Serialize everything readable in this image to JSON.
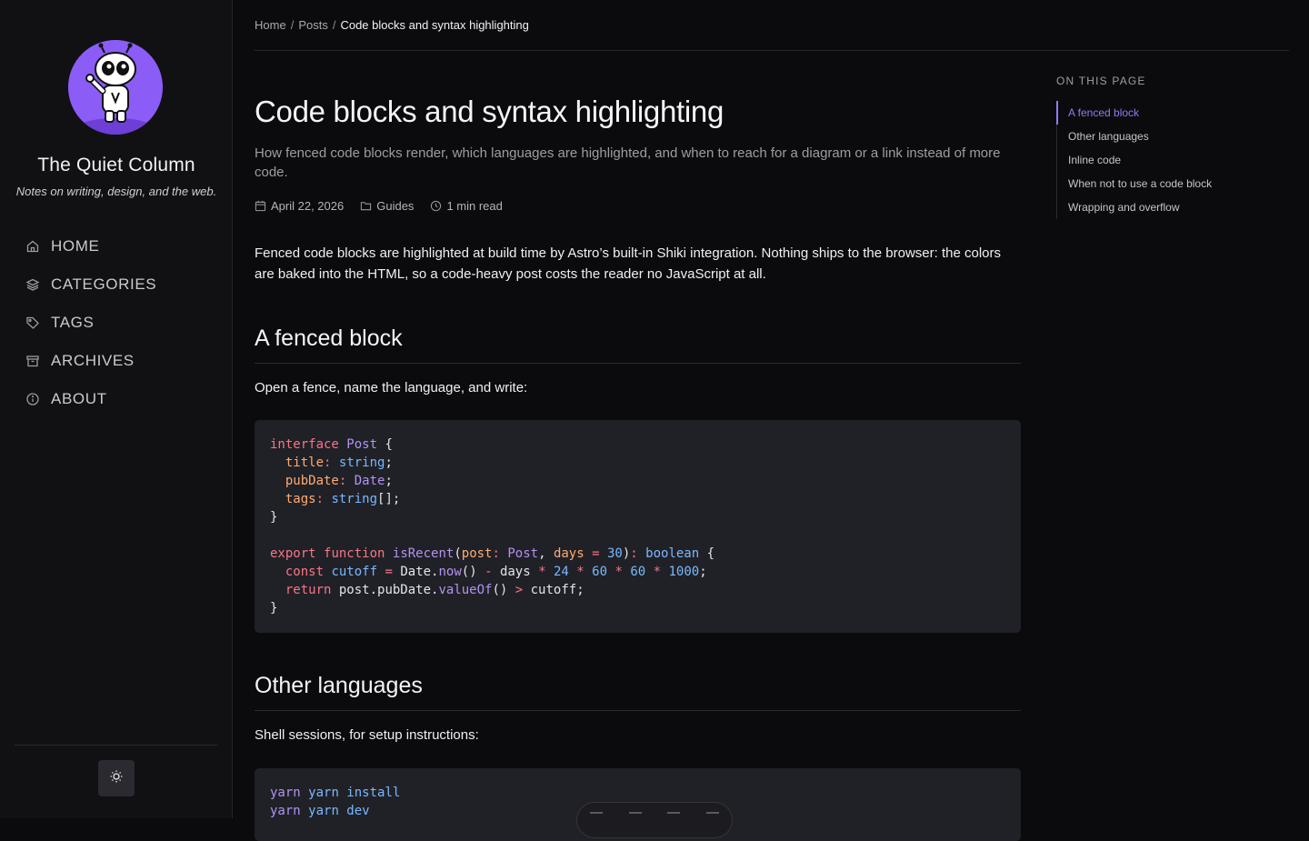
{
  "site": {
    "title": "The Quiet Column",
    "tagline": "Notes on writing, design, and the web.",
    "accent": "#8b5cf6"
  },
  "nav": [
    {
      "label": "HOME",
      "icon": "home-icon"
    },
    {
      "label": "CATEGORIES",
      "icon": "layers-icon"
    },
    {
      "label": "TAGS",
      "icon": "tag-icon"
    },
    {
      "label": "ARCHIVES",
      "icon": "archive-icon"
    },
    {
      "label": "ABOUT",
      "icon": "info-icon"
    }
  ],
  "theme_toggle": {
    "icon": "sun-icon"
  },
  "breadcrumb": {
    "home": "Home",
    "posts": "Posts",
    "current": "Code blocks and syntax highlighting"
  },
  "post": {
    "title": "Code blocks and syntax highlighting",
    "description": "How fenced code blocks render, which languages are highlighted, and when to reach for a diagram or a link instead of more code.",
    "date": "April 22, 2026",
    "category": "Guides",
    "read_time": "1 min read",
    "lead": "Fenced code blocks are highlighted at build time by Astro’s built-in Shiki integration. Nothing ships to the browser: the colors are baked into the HTML, so a code-heavy post costs the reader no JavaScript at all.",
    "section1_heading": "A fenced block",
    "section1_text": "Open a fence, name the language, and write:",
    "section2_heading": "Other languages",
    "section2_text": "Shell sessions, for setup instructions:",
    "shell_lines": [
      "yarn install",
      "yarn dev"
    ]
  },
  "code_colors": {
    "keyword": "#f97583",
    "type": "#b392f0",
    "property": "#ffab70",
    "builtin": "#79b8ff"
  },
  "toc": {
    "heading": "ON THIS PAGE",
    "items": [
      "A fenced block",
      "Other languages",
      "Inline code",
      "When not to use a code block",
      "Wrapping and overflow"
    ]
  }
}
